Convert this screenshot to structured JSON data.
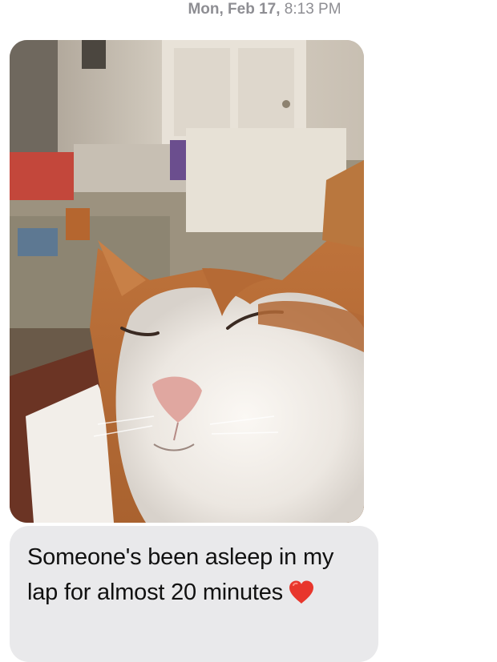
{
  "thread": {
    "timestamp_day": "Mon, Feb 17,",
    "timestamp_time": "8:13 PM"
  },
  "messages": [
    {
      "type": "photo",
      "direction": "received",
      "icon": "cat-photo",
      "description": "Photo of an orange and white cat sleeping with eyes closed in front of a couch"
    },
    {
      "type": "text",
      "direction": "received",
      "text": "Someone's been asleep in my lap for almost 20 minutes",
      "emoji_icon": "heart-icon",
      "emoji_color": "#e8362c"
    }
  ],
  "colors": {
    "received_bubble": "#e9e9eb",
    "timestamp": "#8e8e93"
  }
}
